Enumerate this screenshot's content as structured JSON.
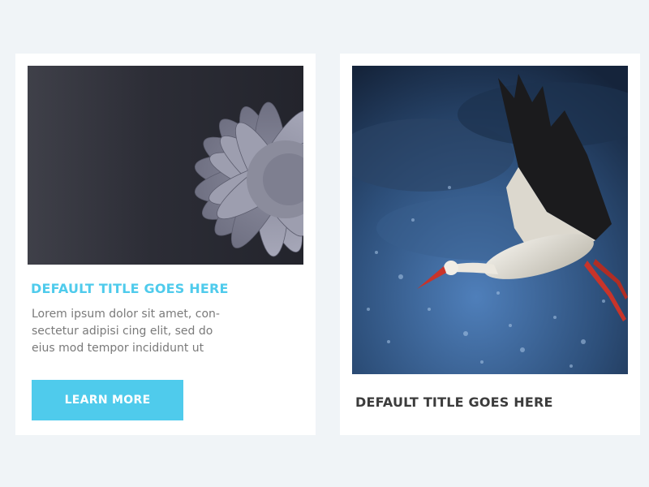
{
  "colors": {
    "page_background": "#f0f4f7",
    "card_background": "#ffffff",
    "accent": "#4fcbec",
    "heading_dark": "#3c3c3c",
    "body_text": "#7a7a7a"
  },
  "cards": [
    {
      "image_icon": "daisy-flower-photo",
      "title": "DEFAULT TITLE GOES HERE",
      "description": "Lorem ipsum dolor sit amet, con-sectetur adipisi cing elit, sed do eius mod tempor incididunt ut",
      "button_label": "LEARN MORE"
    },
    {
      "image_icon": "stork-in-rain-photo",
      "title": "DEFAULT TITLE GOES HERE"
    }
  ]
}
